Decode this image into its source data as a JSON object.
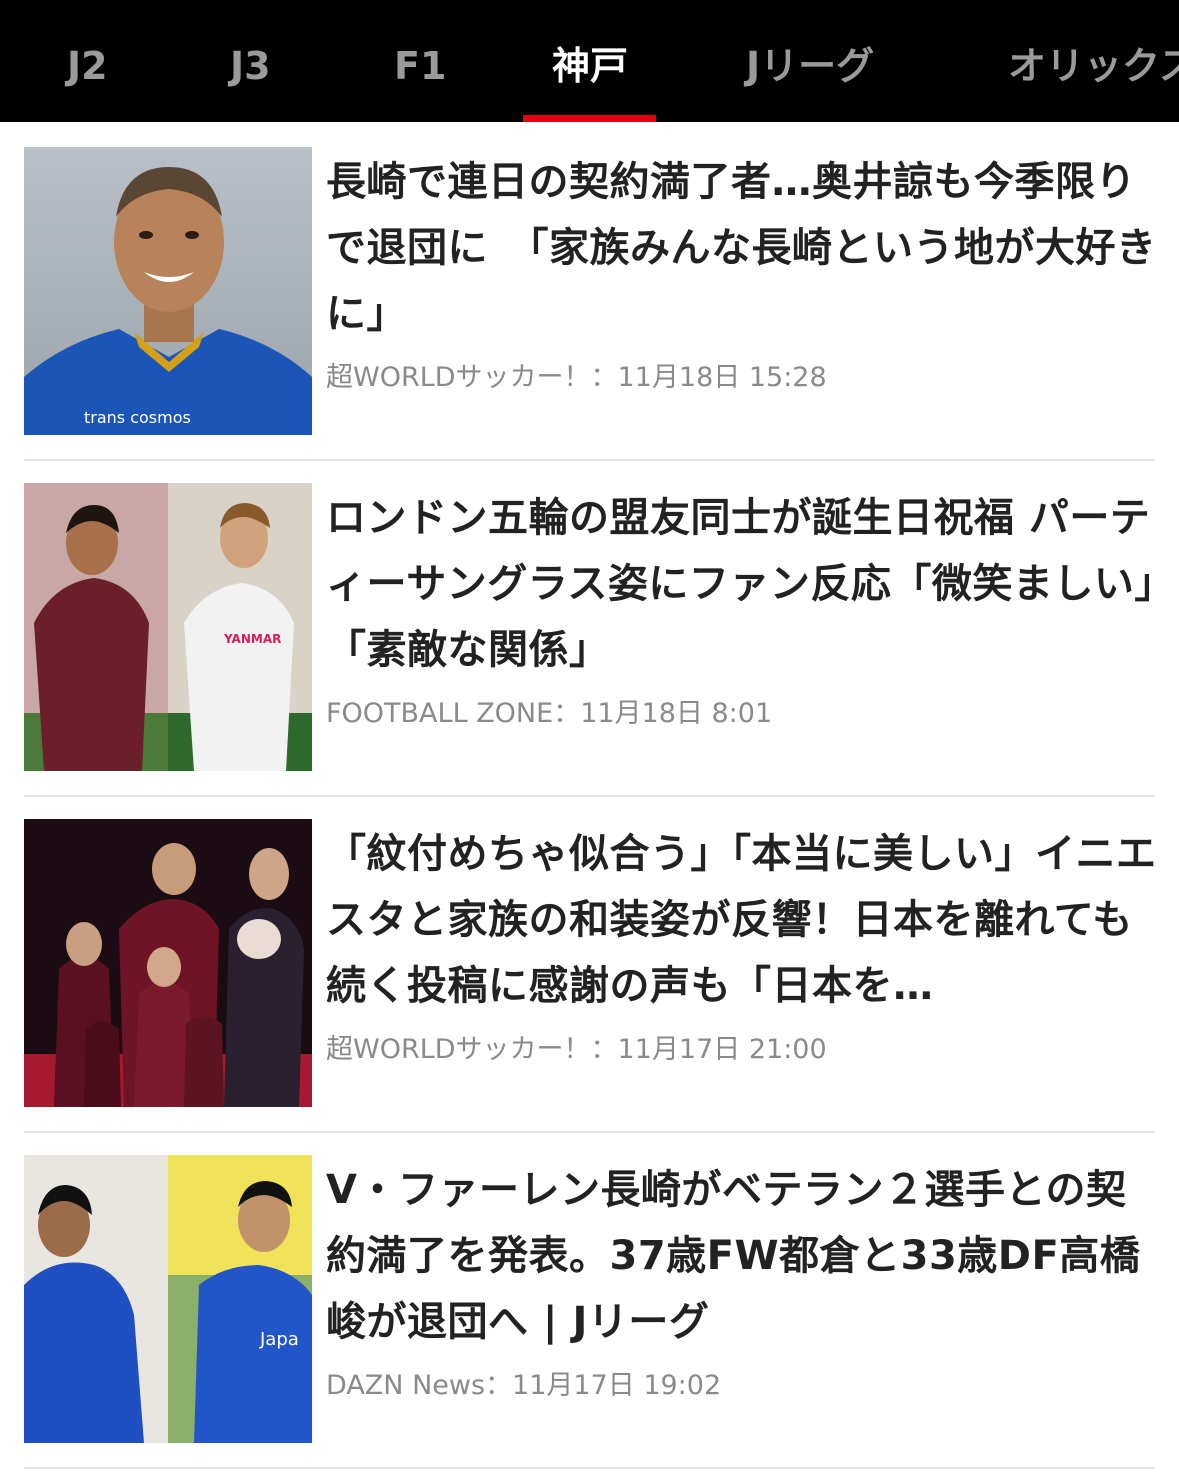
{
  "tabs": [
    {
      "label": "J2",
      "active": false
    },
    {
      "label": "J3",
      "active": false
    },
    {
      "label": "F1",
      "active": false
    },
    {
      "label": "神戸",
      "active": true
    },
    {
      "label": "Jリーグ",
      "active": false
    },
    {
      "label": "オリックス",
      "active": false
    }
  ],
  "colors": {
    "tab_bar": "#000000",
    "accent": "#e50012",
    "meta_text": "#8a8a8a"
  },
  "articles": [
    {
      "headline": "長崎で連日の契約満了者…奥井諒も今季限りで退団に　「家族みんな長崎という地が大好きに」",
      "source": "超WORLDサッカー！",
      "datetime": "11月18日 15:28",
      "thumb_text": "trans cosmos"
    },
    {
      "headline": "ロンドン五輪の盟友同士が誕生日祝福 パーティーサングラス姿にファン反応「微笑ましい」「素敵な関係」",
      "source": "FOOTBALL ZONE",
      "datetime": "11月18日 8:01",
      "thumb_text": "YANMAR"
    },
    {
      "headline": "「紋付めちゃ似合う」「本当に美しい」イニエスタと家族の和装姿が反響！日本を離れても続く投稿に感謝の声も「日本を…",
      "source": "超WORLDサッカー！",
      "datetime": "11月17日 21:00",
      "thumb_text": ""
    },
    {
      "headline": "V・ファーレン長崎がベテラン２選手との契約満了を発表。37歳FW都倉と33歳DF高橋峻が退団へ | Jリーグ",
      "source": "DAZN News",
      "datetime": "11月17日 19:02",
      "thumb_text": "Japa"
    }
  ]
}
